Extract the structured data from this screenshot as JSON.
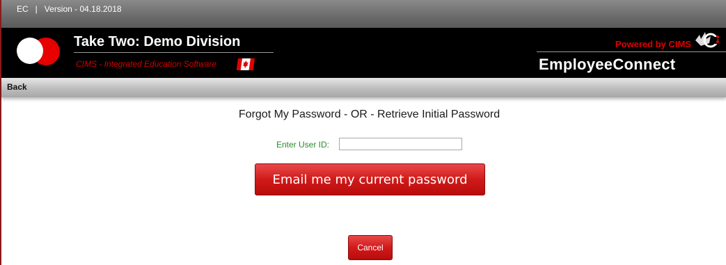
{
  "topbar": {
    "app_code": "EC",
    "separator": "|",
    "version": "Version - 04.18.2018"
  },
  "banner": {
    "org_name": "Take Two: Demo Division",
    "tagline": "CIMS - Integrated Education Software",
    "powered_by": "Powered by CIMS",
    "product_name": "EmployeeConnect",
    "accent_color": "#e00000",
    "flag_icon": "canada-flag-icon",
    "logo_icon": "division-logo-icon"
  },
  "nav": {
    "back_label": "Back"
  },
  "form": {
    "title": "Forgot My Password - OR - Retrieve Initial Password",
    "user_id_label": "Enter User ID:",
    "user_id_value": "",
    "user_id_placeholder": "",
    "email_button_label": "Email me my current password",
    "cancel_button_label": "Cancel"
  }
}
